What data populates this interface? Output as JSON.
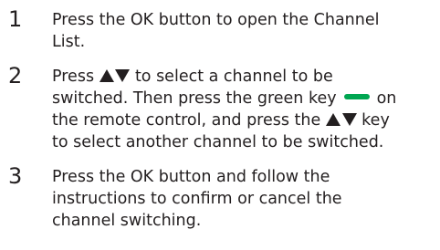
{
  "steps": [
    {
      "number": "1",
      "lines": [
        "Press the OK button to open the Channel",
        "List."
      ]
    },
    {
      "number": "2",
      "line1_after_arrows": " to select a channel to be",
      "line2_before_key": "switched. Then press the green key",
      "line2_after_key": "on",
      "line3_before_arrows": "the remote control, and press the",
      "line3_after_arrows": " key",
      "line4": "to select another channel to be switched.",
      "line1_prefix": "Press "
    },
    {
      "number": "3",
      "lines": [
        "Press the OK button and follow the",
        "instructions to confirm or cancel the",
        "channel switching."
      ]
    }
  ],
  "icons": {
    "arrow_color": "#231f20",
    "green_key_color": "#00a651"
  }
}
